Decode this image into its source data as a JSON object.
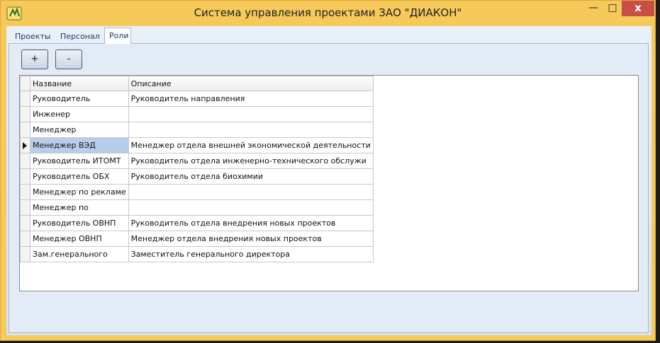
{
  "window": {
    "title": "Система управления проектами ЗАО \"ДИАКОН\"",
    "min_glyph": "—",
    "max_glyph": "□",
    "close_glyph": "x"
  },
  "tabs": [
    {
      "label": "Проекты",
      "active": false
    },
    {
      "label": "Персонал",
      "active": false
    },
    {
      "label": "Роли",
      "active": true
    }
  ],
  "toolbar": {
    "add_label": "+",
    "remove_label": "-"
  },
  "grid": {
    "columns": [
      "Название",
      "Описание"
    ],
    "current_row": 3,
    "rows": [
      {
        "name": "Руководитель",
        "description": "Руководитель направления"
      },
      {
        "name": "Инженер",
        "description": ""
      },
      {
        "name": "Менеджер",
        "description": ""
      },
      {
        "name": "Менеджер ВЭД",
        "description": "Менеджер отдела внешней экономической деятельности"
      },
      {
        "name": "Руководитель ИТОМТ",
        "description": "Руководитель отдела инженерно-технического обслужи"
      },
      {
        "name": "Руководитель ОБХ",
        "description": "Руководитель отдела биохимии"
      },
      {
        "name": "Менеджер по рекламе",
        "description": ""
      },
      {
        "name": "Менеджер по",
        "description": ""
      },
      {
        "name": "Руководитель ОВНП",
        "description": "Руководитель отдела внедрения новых проектов"
      },
      {
        "name": "Менеджер ОВНП",
        "description": "Менеджер отдела внедрения новых проектов"
      },
      {
        "name": "Зам.генерального",
        "description": "Заместитель генерального директора"
      }
    ]
  }
}
